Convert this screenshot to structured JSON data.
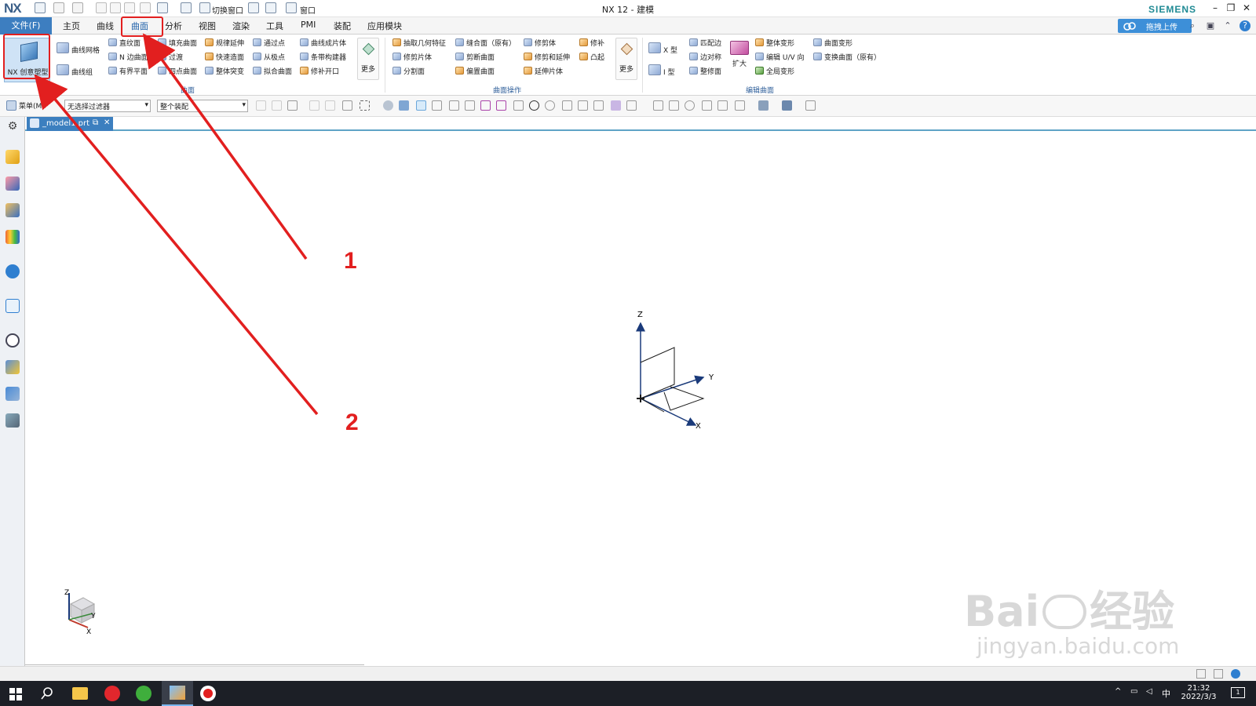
{
  "app": {
    "logo": "NX",
    "title": "NX 12 - 建模",
    "brand": "SIEMENS"
  },
  "quick_access": {
    "switch_window": "切换窗口",
    "window": "窗口"
  },
  "menu": {
    "file": "文件(F)",
    "tabs": [
      "主页",
      "曲线",
      "曲面",
      "分析",
      "视图",
      "渲染",
      "工具",
      "PMI",
      "装配",
      "应用模块"
    ],
    "active_tab": "曲面",
    "upload": "拖拽上传"
  },
  "ribbon": {
    "big_button": "NX 创意塑型",
    "col1": [
      "曲线网格",
      "曲线组"
    ],
    "col2": [
      "直纹面",
      "N 边曲面",
      "有界平面"
    ],
    "col3": [
      "填充曲面",
      "过渡",
      "四点曲面"
    ],
    "col4": [
      "规律延伸",
      "快速造面",
      "整体突变"
    ],
    "col5": [
      "通过点",
      "从极点",
      "拟合曲面"
    ],
    "col6": [
      "曲线成片体",
      "条带构建器",
      "修补开口"
    ],
    "more": "更多",
    "group_surface": "曲面",
    "op_col1": [
      "抽取几何特征",
      "修剪片体",
      "分割面"
    ],
    "op_col2": [
      "缝合面（原有）",
      "剪断曲面",
      "偏置曲面"
    ],
    "op_col3": [
      "修剪体",
      "修剪和延伸",
      "延伸片体"
    ],
    "op_col4": [
      "修补",
      "凸起"
    ],
    "group_surface_ops": "曲面操作",
    "edit_col1": [
      "X 型",
      "I 型"
    ],
    "edit_col2": [
      "匹配边",
      "边对称",
      "整修面"
    ],
    "edit_expand": "扩大",
    "edit_col3": [
      "整体变形",
      "编辑 U/V 向",
      "全局变形"
    ],
    "edit_col4": [
      "曲面变形",
      "变换曲面（原有）"
    ],
    "group_edit_surface": "编辑曲面"
  },
  "toolbar": {
    "menu": "菜单(M)",
    "filter": "无选择过滤器",
    "assembly": "整个装配"
  },
  "doc_tab": {
    "label": "_model1.prt"
  },
  "annotations": [
    "1",
    "2"
  ],
  "axes": {
    "x": "X",
    "y": "Y",
    "z": "Z"
  },
  "watermark": {
    "brand": "Bai",
    "brand2": "经验",
    "url": "jingyan.baidu.com"
  },
  "taskbar": {
    "ime": "中",
    "time": "21:32",
    "date": "2022/3/3",
    "notif": "1"
  },
  "colors": {
    "accent": "#3d7ec0",
    "annotation_red": "#e21f1f"
  }
}
